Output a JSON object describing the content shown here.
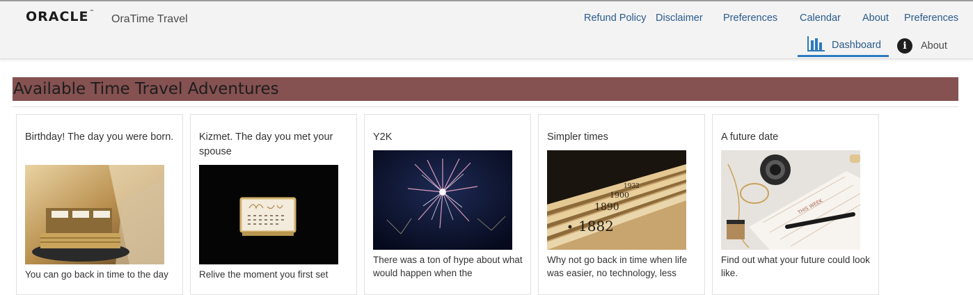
{
  "header": {
    "logo": "ORACLE",
    "logo_mark": "™",
    "app_title": "OraTime Travel",
    "nav": [
      {
        "label": "Refund Policy"
      },
      {
        "label": "Disclaimer"
      },
      {
        "label": "Preferences"
      },
      {
        "label": "Calendar"
      },
      {
        "label": "About"
      },
      {
        "label": "Preferences"
      }
    ],
    "tabs": [
      {
        "label": "Dashboard",
        "icon": "bar-chart-icon",
        "selected": true
      },
      {
        "label": "About",
        "icon": "info-icon",
        "selected": false
      }
    ]
  },
  "banner": {
    "title": "Available Time Travel Adventures",
    "color": "#855151"
  },
  "cards": [
    {
      "title": "Birthday! The day you were born.",
      "description": "You can go back in time to the day",
      "image": "birthday-calendar-image"
    },
    {
      "title": "Kizmet. The day you met your spouse",
      "description": "Relive the moment you first set",
      "image": "may-calendar-image"
    },
    {
      "title": "Y2K",
      "description": "There was a ton of hype about what would happen when the",
      "image": "fireworks-image"
    },
    {
      "title": "Simpler times",
      "description": "Why not go back in time when life was easier, no technology, less",
      "image": "year-drawers-image"
    },
    {
      "title": "A future date",
      "description": "Find out what your future could look like.",
      "image": "this-week-planner-image"
    }
  ],
  "colors": {
    "link": "#2a5a8c",
    "tab_underline": "#2a7ac0",
    "header_bg": "#f3f3f3"
  }
}
